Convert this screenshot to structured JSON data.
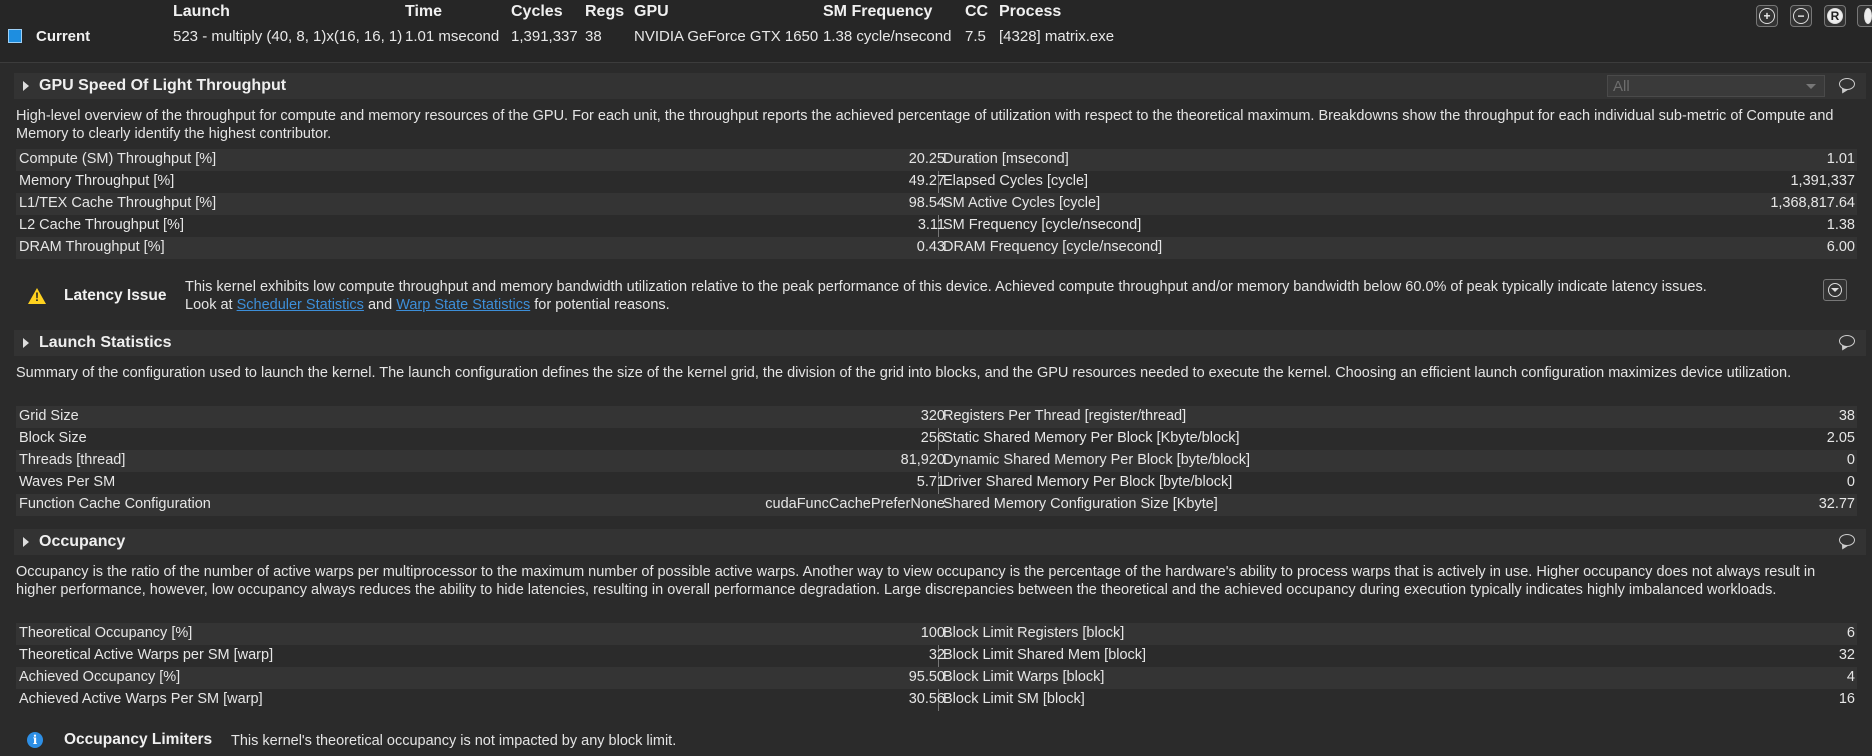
{
  "header": {
    "labels": {
      "launch": "Launch",
      "time": "Time",
      "cycles": "Cycles",
      "regs": "Regs",
      "gpu": "GPU",
      "sm_frequency": "SM Frequency",
      "cc": "CC",
      "process": "Process"
    },
    "current_label": "Current",
    "values": {
      "launch": "523 - multiply (40, 8, 1)x(16, 16, 1)",
      "time": "1.01 msecond",
      "cycles": "1,391,337",
      "regs": "38",
      "gpu": "NVIDIA GeForce GTX 1650",
      "sm_frequency": "1.38 cycle/nsecond",
      "cc": "7.5",
      "process": "[4328] matrix.exe"
    },
    "swatch_color": "#1e8ee0",
    "buttons": {
      "add": "+",
      "remove": "−",
      "reset": "R"
    }
  },
  "sections": {
    "sol": {
      "title": "GPU Speed Of Light Throughput",
      "filter_value": "All",
      "description": "High-level overview of the throughput for compute and memory resources of the GPU. For each unit, the throughput reports the achieved percentage of utilization with respect to the theoretical maximum. Breakdowns show the throughput for each individual sub-metric of Compute and Memory to clearly identify the highest contributor.",
      "rows": [
        {
          "ln": "Compute (SM) Throughput [%]",
          "lv": "20.25",
          "rn": "Duration [msecond]",
          "rv": "1.01"
        },
        {
          "ln": "Memory Throughput [%]",
          "lv": "49.27",
          "rn": "Elapsed Cycles [cycle]",
          "rv": "1,391,337"
        },
        {
          "ln": "L1/TEX Cache Throughput [%]",
          "lv": "98.54",
          "rn": "SM Active Cycles [cycle]",
          "rv": "1,368,817.64"
        },
        {
          "ln": "L2 Cache Throughput [%]",
          "lv": "3.11",
          "rn": "SM Frequency [cycle/nsecond]",
          "rv": "1.38"
        },
        {
          "ln": "DRAM Throughput [%]",
          "lv": "0.43",
          "rn": "DRAM Frequency [cycle/nsecond]",
          "rv": "6.00"
        }
      ],
      "issue": {
        "title": "Latency Issue",
        "text_1": "This kernel exhibits low compute throughput and memory bandwidth utilization relative to the peak performance of this device. Achieved compute throughput and/or memory bandwidth below 60.0% of peak typically indicate latency issues.",
        "text_2a": "Look at ",
        "link_1": "Scheduler Statistics",
        "text_2b": " and ",
        "link_2": "Warp State Statistics",
        "text_2c": " for potential reasons."
      }
    },
    "launch": {
      "title": "Launch Statistics",
      "description": "Summary of the configuration used to launch the kernel. The launch configuration defines the size of the kernel grid, the division of the grid into blocks, and the GPU resources needed to execute the kernel. Choosing an efficient launch configuration maximizes device utilization.",
      "rows": [
        {
          "ln": "Grid Size",
          "lv": "320",
          "rn": "Registers Per Thread [register/thread]",
          "rv": "38"
        },
        {
          "ln": "Block Size",
          "lv": "256",
          "rn": "Static Shared Memory Per Block [Kbyte/block]",
          "rv": "2.05"
        },
        {
          "ln": "Threads [thread]",
          "lv": "81,920",
          "rn": "Dynamic Shared Memory Per Block [byte/block]",
          "rv": "0"
        },
        {
          "ln": "Waves Per SM",
          "lv": "5.71",
          "rn": "Driver Shared Memory Per Block [byte/block]",
          "rv": "0"
        },
        {
          "ln": "Function Cache Configuration",
          "lv": "cudaFuncCachePreferNone",
          "rn": "Shared Memory Configuration Size [Kbyte]",
          "rv": "32.77"
        }
      ]
    },
    "occupancy": {
      "title": "Occupancy",
      "description": "Occupancy is the ratio of the number of active warps per multiprocessor to the maximum number of possible active warps. Another way to view occupancy is the percentage of the hardware's ability to process warps that is actively in use. Higher occupancy does not always result in higher performance, however, low occupancy always reduces the ability to hide latencies, resulting in overall performance degradation. Large discrepancies between the theoretical and the achieved occupancy during execution typically indicates highly imbalanced workloads.",
      "rows": [
        {
          "ln": "Theoretical Occupancy [%]",
          "lv": "100",
          "rn": "Block Limit Registers [block]",
          "rv": "6"
        },
        {
          "ln": "Theoretical Active Warps per SM [warp]",
          "lv": "32",
          "rn": "Block Limit Shared Mem [block]",
          "rv": "32"
        },
        {
          "ln": "Achieved Occupancy [%]",
          "lv": "95.50",
          "rn": "Block Limit Warps [block]",
          "rv": "4"
        },
        {
          "ln": "Achieved Active Warps Per SM [warp]",
          "lv": "30.56",
          "rn": "Block Limit SM [block]",
          "rv": "16"
        }
      ],
      "limiters": {
        "title": "Occupancy Limiters",
        "text": "This kernel's theoretical occupancy is not impacted by any block limit."
      }
    }
  }
}
